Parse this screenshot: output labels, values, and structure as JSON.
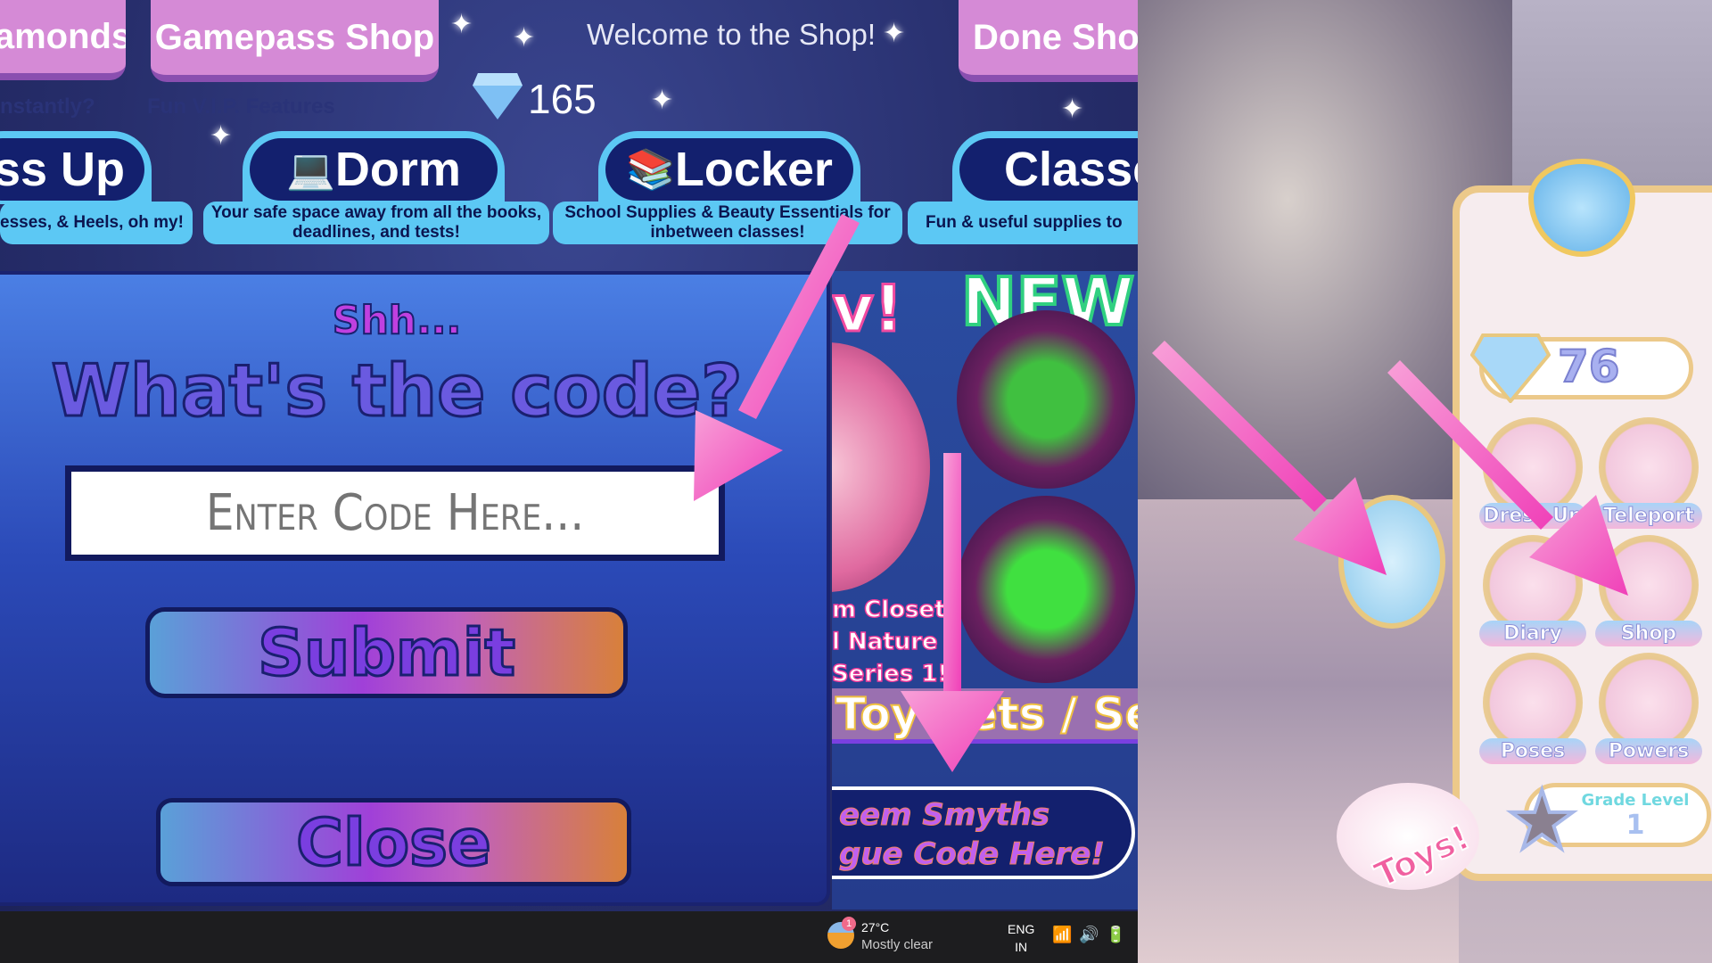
{
  "shop": {
    "top_buttons": [
      "amonds",
      "Gamepass Shop",
      "Done Shop"
    ],
    "welcome": "Welcome to the Shop!",
    "diamonds": "165",
    "subtexts": [
      "nstantly?",
      "Fun V.I.P. Features"
    ],
    "tabs": [
      {
        "label": "ess Up",
        "desc": "esses, & Heels, oh my!"
      },
      {
        "label": "Dorm",
        "desc": "Your safe space away from all the books, deadlines, and tests!",
        "icon": "laptop-icon"
      },
      {
        "label": "Locker",
        "desc": "School Supplies & Beauty Essentials for inbetween classes!",
        "icon": "books-icon"
      },
      {
        "label": "Classe",
        "desc": "Fun & useful supplies to"
      }
    ]
  },
  "code_modal": {
    "hint": "Shh...",
    "title": "What's the code?",
    "input_placeholder": "Enter Code Here...",
    "submit_label": "Submit",
    "close_label": "Close"
  },
  "promo": {
    "left_heading": "v!",
    "right_heading": "NEW!",
    "caption": [
      "m Closet",
      "l Nature",
      "Series 1!"
    ],
    "banner": "Toy Sets / Se",
    "redeem": [
      "eem Smyths",
      "gue Code Here!"
    ]
  },
  "taskbar": {
    "weather_badge": "1",
    "temperature": "27°C",
    "weather": "Mostly clear",
    "lang": "ENG",
    "region": "IN"
  },
  "game_menu": {
    "diamonds": "76",
    "items": [
      "Dress Up",
      "Teleport",
      "Diary",
      "Shop",
      "Poses",
      "Powers"
    ],
    "grade_label": "Grade Level",
    "grade": "1",
    "toys_label": "Toys!"
  },
  "colors": {
    "arrow": "#f055c0",
    "tab": "#5cc8f4",
    "tab_inner": "#13206e",
    "pink_button": "#d58ad6"
  }
}
